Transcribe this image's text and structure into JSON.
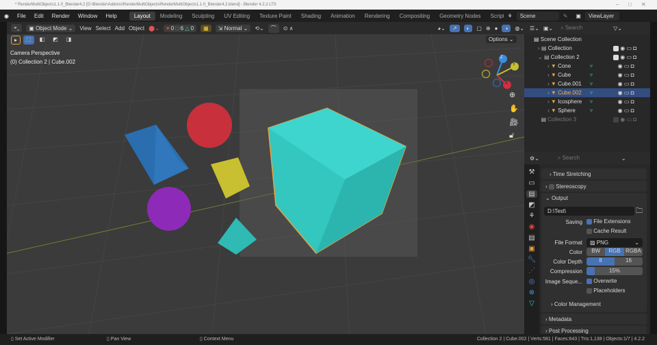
{
  "window": {
    "title": "* RenderMultiObjects1.1.0_Blender4.2 [D:\\Blender\\Addons\\RenderMultiObjects\\RenderMultiObjects1.1.0_Blender4.2.blend] - Blender 4.2.2 LTS",
    "minimize": "–",
    "maximize": "□",
    "close": "✕"
  },
  "menu": [
    "File",
    "Edit",
    "Render",
    "Window",
    "Help"
  ],
  "workspaces": [
    "Layout",
    "Modeling",
    "Sculpting",
    "UV Editing",
    "Texture Paint",
    "Shading",
    "Animation",
    "Rendering",
    "Compositing",
    "Geometry Nodes",
    "Scripting"
  ],
  "scene": "Scene",
  "view_layer": "ViewLayer",
  "viewport_header": {
    "mode": "Object Mode",
    "view": "View",
    "select": "Select",
    "add": "Add",
    "object": "Object",
    "counts": [
      "0",
      "6",
      "0"
    ],
    "orientation": "Normal",
    "options": "Options"
  },
  "viewport": {
    "camera_label": "Camera Perspective",
    "context_label": "(0) Collection 2 | Cube.002",
    "gizmo": {
      "z": "Z",
      "y": "Y",
      "x": "X"
    }
  },
  "outliner": {
    "search_placeholder": "Search",
    "root": "Scene Collection",
    "items": [
      {
        "name": "Collection",
        "level": 1
      },
      {
        "name": "Collection 2",
        "level": 1
      },
      {
        "name": "Cone",
        "level": 2
      },
      {
        "name": "Cube",
        "level": 2
      },
      {
        "name": "Cube.001",
        "level": 2
      },
      {
        "name": "Cube.002",
        "level": 2,
        "selected": true
      },
      {
        "name": "Icosphere",
        "level": 2
      },
      {
        "name": "Sphere",
        "level": 2
      },
      {
        "name": "Collection 3",
        "level": 1,
        "disabled": true
      }
    ]
  },
  "properties": {
    "search_placeholder": "Search",
    "time_stretching": "Time Stretching",
    "stereoscopy": "Stereoscopy",
    "output": "Output",
    "path": "D:\\Test\\",
    "saving_label": "Saving",
    "file_extensions": "File Extensions",
    "cache_result": "Cache Result",
    "file_format_label": "File Format",
    "file_format": "PNG",
    "color_label": "Color",
    "color_options": [
      "BW",
      "RGB",
      "RGBA"
    ],
    "color_selected": "RGB",
    "color_depth_label": "Color Depth",
    "depth_options": [
      "8",
      "16"
    ],
    "compression_label": "Compression",
    "compression": "15%",
    "compression_value": 15,
    "image_sequence_label": "Image Seque...",
    "overwrite": "Overwrite",
    "placeholders": "Placeholders",
    "color_management": "Color Management",
    "metadata": "Metadata",
    "post_processing": "Post Processing"
  },
  "status": {
    "left": [
      "Set Active Modifier",
      "Pan View",
      "Context Menu"
    ],
    "right": "Collection 2 | Cube.002 | Verts:581 | Faces:643 | Tris:1,138 | Objects:1/7 | 4.2.2"
  },
  "colors": {
    "accent": "#4772b3",
    "selection": "#334d80",
    "object": "#e8a33d",
    "cyan": "#33c7c0"
  }
}
